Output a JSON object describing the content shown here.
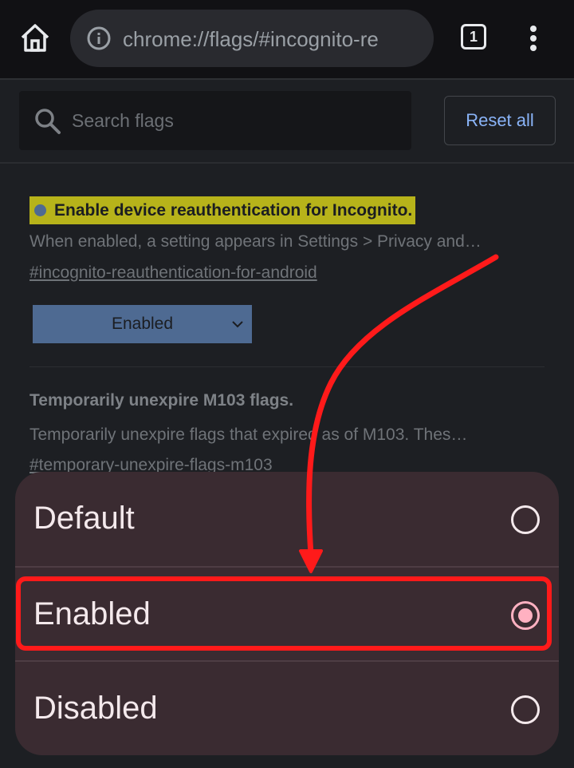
{
  "browser": {
    "url": "chrome://flags/#incognito-re",
    "tab_count": "1",
    "icons": {
      "home": "home-icon",
      "info": "info-icon",
      "tabs": "tab-switcher-icon",
      "menu": "more-vert-icon"
    }
  },
  "header": {
    "search_placeholder": "Search flags",
    "reset_label": "Reset all"
  },
  "flags": [
    {
      "title": "Enable device reauthentication for Incognito.",
      "description": "When enabled, a setting appears in Settings > Privacy and…",
      "link": "#incognito-reauthentication-for-android",
      "value": "Enabled"
    },
    {
      "title": "Temporarily unexpire M103 flags.",
      "description": "Temporarily unexpire flags that expired as of M103. Thes…",
      "link": "#temporary-unexpire-flags-m103"
    }
  ],
  "dialog": {
    "options": [
      {
        "label": "Default",
        "selected": false
      },
      {
        "label": "Enabled",
        "selected": true
      },
      {
        "label": "Disabled",
        "selected": false
      }
    ]
  },
  "colors": {
    "accent": "#8ab4f8",
    "highlight": "#b7b31a",
    "select_bg": "#4e6a92",
    "dialog_bg": "#3a2b31",
    "radio_selected": "#ffb1c1",
    "annotation": "#ff1a1a"
  }
}
